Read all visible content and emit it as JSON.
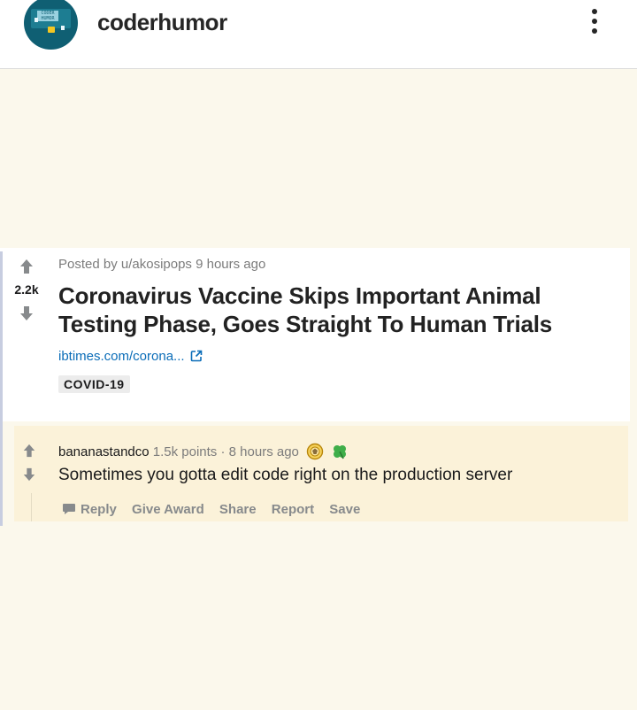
{
  "header": {
    "username": "coderhumor",
    "avatar_text": "CODER HUMOR",
    "avatar_colors": {
      "background": "#0f5f73",
      "accent": "#f3c623"
    },
    "more_icon": "vertical-ellipsis-icon"
  },
  "post": {
    "score": "2.2k",
    "posted_by": "Posted by u/akosipops 9 hours ago",
    "title": "Coronavirus Vaccine Skips Important Animal Testing Phase, Goes Straight To Human Trials",
    "link_text": "ibtimes.com/corona...",
    "link_icon": "external-link-icon",
    "flair": "COVID-19",
    "icons": {
      "upvote": "upvote-arrow-icon",
      "downvote": "downvote-arrow-icon"
    }
  },
  "comment": {
    "author": "bananastandco",
    "points": "1.5k points",
    "separator": "·",
    "time": "8 hours ago",
    "awards": [
      "silver-award-icon",
      "clover-award-icon"
    ],
    "body": "Sometimes you gotta edit code right on the production server",
    "actions": {
      "reply": "Reply",
      "give_award": "Give Award",
      "share": "Share",
      "report": "Report",
      "save": "Save"
    }
  },
  "colors": {
    "page_background": "#fbf8ec",
    "comment_background": "#fbf2d9",
    "link": "#0b6db8",
    "muted": "#7c7c7c"
  }
}
